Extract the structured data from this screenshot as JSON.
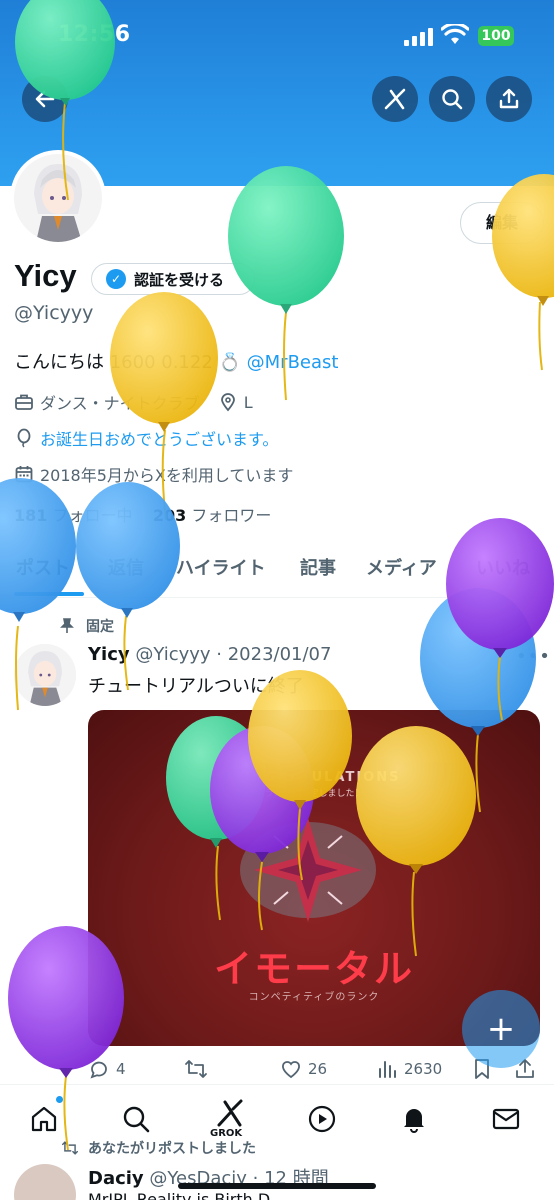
{
  "status_bar": {
    "time": "12:56",
    "battery": "100"
  },
  "header": {
    "back_icon": "arrow-left-icon",
    "grok_icon": "grok-icon",
    "search_icon": "search-icon",
    "share_icon": "share-icon"
  },
  "profile": {
    "edit_label": "編集",
    "name": "Yicy",
    "verify_label": "認証を受ける",
    "handle": "@Yicyyy",
    "bio_text": "こんにちは 1600 0.122 💍",
    "bio_mention": "@MrBeast",
    "category": "ダンス・ナイトクラブ",
    "location": "L",
    "birthday": "お誕生日おめでとうございます。",
    "joined": "2018年5月からXを利用しています",
    "following_count": "181",
    "following_label": "フォロー中",
    "followers_count": "203",
    "followers_label": "フォロワー"
  },
  "tabs": [
    "ポスト",
    "返信",
    "ハイライト",
    "記事",
    "メディア",
    "いいね"
  ],
  "post": {
    "pinned_label": "固定",
    "author": "Yicy",
    "handle_date": "@Yicyyy · 2023/01/07",
    "text": "チュートリアルついに終了",
    "media": {
      "congrats": "CONGRATULATIONS",
      "congrats_sub": "ランクが確定しました！",
      "rank": "イモータル",
      "rank_sub": "コンペティティブのランク"
    },
    "replies": "4",
    "reposts": "",
    "likes": "26",
    "views": "2630"
  },
  "fab_label": "+",
  "nav": {
    "grok_label": "GROK"
  },
  "next_post": {
    "repost_note": "あなたがリポストしました",
    "author": "Daciy",
    "handle_time": "@YesDaciy · 12 時間",
    "text": "MrIPL Reality is Birth D..."
  },
  "colors": {
    "accent": "#1d9bf0",
    "banner": "#2a97ea",
    "balloon_green": "#3ddc97",
    "balloon_yellow": "#f5c518",
    "balloon_blue": "#3fa7f0",
    "balloon_purple": "#8e2de2"
  }
}
